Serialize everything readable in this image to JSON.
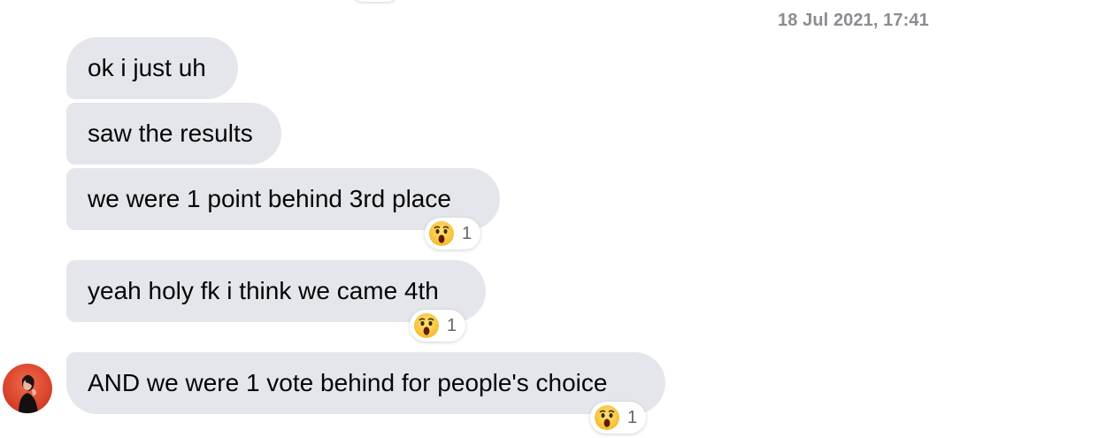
{
  "header": {
    "timestamp": "18 Jul 2021, 17:41"
  },
  "messages": [
    {
      "text": "ok i just uh"
    },
    {
      "text": "saw the results"
    },
    {
      "text": "we were 1 point behind 3rd place",
      "reaction": {
        "icon": "wow-emoji-icon",
        "count": "1"
      }
    },
    {
      "text": "yeah holy fk i think we came 4th",
      "reaction": {
        "icon": "wow-emoji-icon",
        "count": "1"
      }
    },
    {
      "text": "AND we were 1 vote behind for people's choice",
      "reaction": {
        "icon": "wow-emoji-icon",
        "count": "1"
      }
    }
  ],
  "colors": {
    "bubble_background": "#e4e6eb",
    "bubble_text": "#050505",
    "timestamp_text": "#8a8d91",
    "avatar_background": "#d9432c"
  }
}
